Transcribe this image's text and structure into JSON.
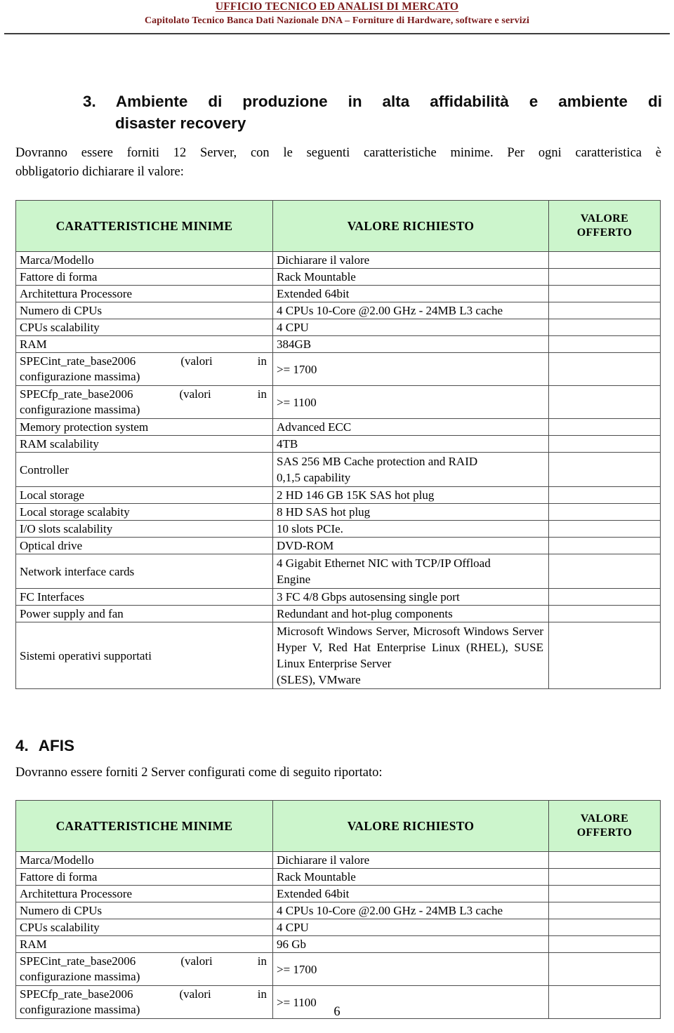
{
  "header": {
    "line1": "UFFICIO TECNICO ED ANALISI DI MERCATO",
    "line2": "Capitolato Tecnico Banca Dati Nazionale DNA – Forniture di Hardware, software e servizi",
    "accent_color": "#7a1a1a"
  },
  "section3": {
    "number": "3.",
    "title_line1": "Ambiente di produzione in alta affidabilità e ambiente di",
    "title_line2": "disaster recovery",
    "intro_line1": "Dovranno essere forniti 12 Server, con le seguenti caratteristiche minime. Per ogni caratteristica è",
    "intro_line2": "obbligatorio dichiarare il valore:"
  },
  "section4": {
    "number": "4.",
    "title": "AFIS",
    "intro": "Dovranno essere forniti 2 Server configurati come di seguito riportato:"
  },
  "table_headers": {
    "col1": "CARATTERISTICHE MINIME",
    "col2": "VALORE RICHIESTO",
    "col3_line1": "VALORE",
    "col3_line2": "OFFERTO",
    "header_bg": "#ccf5cc"
  },
  "table1": {
    "rows": [
      {
        "label": "Marca/Modello",
        "value": "Dichiarare il valore"
      },
      {
        "label": "Fattore di forma",
        "value": "Rack Mountable"
      },
      {
        "label": "Architettura Processore",
        "value": "Extended 64bit"
      },
      {
        "label": "Numero di CPUs",
        "value": "4 CPUs 10-Core @2.00 GHz - 24MB L3 cache"
      },
      {
        "label": "CPUs scalability",
        "value": "4 CPU"
      },
      {
        "label": "RAM",
        "value": "384GB"
      },
      {
        "label_l1": "SPECint_rate_base2006 (valori in",
        "label_l2": "configurazione massima)",
        "value": ">= 1700"
      },
      {
        "label_l1": "SPECfp_rate_base2006 (valori in",
        "label_l2": "configurazione massima)",
        "value": ">= 1100"
      },
      {
        "label": "Memory protection system",
        "value": "Advanced ECC"
      },
      {
        "label": "RAM scalability",
        "value": "4TB"
      },
      {
        "label": "Controller",
        "value_l1": "SAS 256 MB Cache protection and RAID",
        "value_l2": "0,1,5 capability"
      },
      {
        "label": "Local storage",
        "value": "2 HD 146 GB 15K SAS hot plug"
      },
      {
        "label": "Local storage scalabity",
        "value": "8 HD SAS hot plug"
      },
      {
        "label": "I/O slots scalability",
        "value": "10 slots PCIe."
      },
      {
        "label": "Optical drive",
        "value": "DVD-ROM"
      },
      {
        "label": "Network interface cards",
        "value_l1": "4 Gigabit Ethernet NIC with TCP/IP Offload",
        "value_l2": "Engine"
      },
      {
        "label": "FC Interfaces",
        "value": "3 FC 4/8 Gbps autosensing single port"
      },
      {
        "label": "Power supply and fan",
        "value": "Redundant and hot-plug components"
      },
      {
        "label": "Sistemi operativi supportati",
        "value_l1": "Microsoft Windows Server, Microsoft",
        "value_l2": "Windows Server Hyper V, Red Hat Enterprise",
        "value_l3": "Linux (RHEL), SUSE Linux Enterprise Server",
        "value_l4": "(SLES), VMware"
      }
    ]
  },
  "table2": {
    "rows": [
      {
        "label": "Marca/Modello",
        "value": "Dichiarare il valore"
      },
      {
        "label": "Fattore di forma",
        "value": "Rack Mountable"
      },
      {
        "label": "Architettura Processore",
        "value": "Extended 64bit"
      },
      {
        "label": "Numero di CPUs",
        "value": "4 CPUs 10-Core @2.00 GHz - 24MB L3 cache"
      },
      {
        "label": "CPUs scalability",
        "value": "4 CPU"
      },
      {
        "label": "RAM",
        "value": "96 Gb"
      },
      {
        "label_l1": "SPECint_rate_base2006 (valori in",
        "label_l2": "configurazione massima)",
        "value": ">= 1700"
      },
      {
        "label_l1": "SPECfp_rate_base2006 (valori in",
        "label_l2": "configurazione massima)",
        "value": ">= 1100"
      }
    ]
  },
  "footer": {
    "page_number": "6"
  }
}
